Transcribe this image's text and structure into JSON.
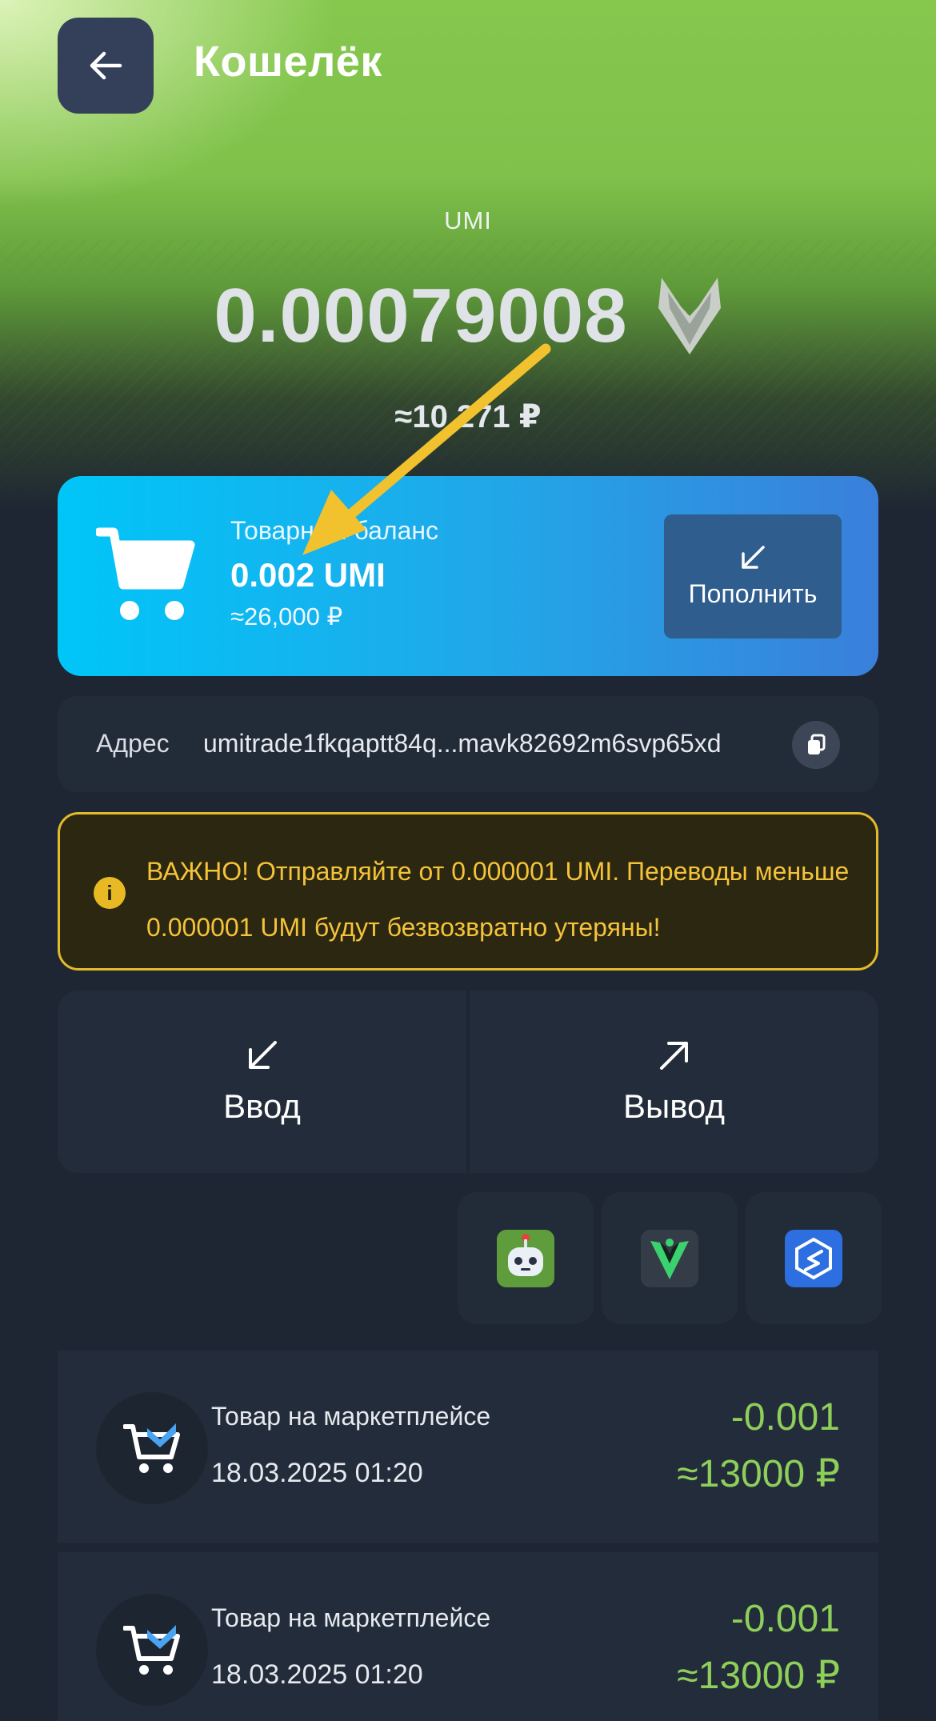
{
  "header": {
    "title": "Кошелёк",
    "back_icon": "arrow-left-icon"
  },
  "balance": {
    "currency": "UMI",
    "amount": "0.00079008",
    "fiat": "≈10 271 ₽",
    "logo_icon": "umi-fox-logo-icon"
  },
  "goods_balance": {
    "label": "Товарный баланс",
    "amount": "0.002 UMI",
    "fiat": "≈26,000 ₽",
    "topup_label": "Пополнить",
    "icon": "shopping-cart-icon"
  },
  "address": {
    "label": "Адрес",
    "value": "umitrade1fkqaptt84q...mavk82692m6svp65xd",
    "copy_icon": "copy-icon"
  },
  "warning": {
    "text": "ВАЖНО! Отправляйте от 0.000001 UMI. Переводы меньше 0.000001 UMI будут безвозвратно утеряны!",
    "icon": "info-icon",
    "color": "#e3bb2a"
  },
  "actions": [
    {
      "label": "Ввод",
      "icon": "arrow-down-left-icon"
    },
    {
      "label": "Вывод",
      "icon": "arrow-up-right-icon"
    }
  ],
  "apps": [
    {
      "icon": "robot-app-icon"
    },
    {
      "icon": "green-v-app-icon"
    },
    {
      "icon": "blue-s-app-icon"
    }
  ],
  "transactions": [
    {
      "title": "Товар на маркетплейсе",
      "date": "18.03.2025 01:20",
      "amount": "-0.001",
      "fiat": "≈13000 ₽"
    },
    {
      "title": "Товар на маркетплейсе",
      "date": "18.03.2025 01:20",
      "amount": "-0.001",
      "fiat": "≈13000 ₽"
    }
  ],
  "colors": {
    "accent_green": "#8ecf5a",
    "card_blue": "#22a6e8",
    "annotation_arrow": "#f2c12e"
  }
}
